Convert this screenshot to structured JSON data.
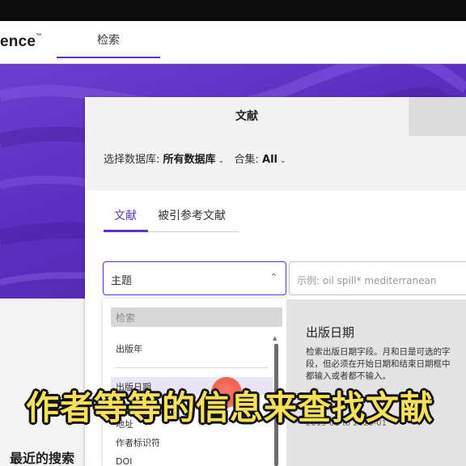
{
  "header": {
    "brand": "ence",
    "brand_mark": "™",
    "nav_tab": "检索"
  },
  "search_panel": {
    "header_tab": "文献",
    "database_label": "选择数据库:",
    "database_value": "所有数据库",
    "collection_label": "合集:",
    "collection_value": "All",
    "subtabs": [
      "文献",
      "被引参考文献"
    ],
    "field_select_value": "主题",
    "query_placeholder": "示例: oil spill* mediterranean"
  },
  "dropdown": {
    "search_placeholder": "检索",
    "items": [
      "出版年",
      "出版日期",
      "地址",
      "作者标识符",
      "DOI"
    ]
  },
  "info_card": {
    "title": "出版日期",
    "description": "检索出版日期字段。月和日是可选的字段，但必须在开始日期和结束日期框中都输入或者都不输入。",
    "example": "2019-01 to 2020-01"
  },
  "recent_searches": "最近的搜索",
  "caption": "作者等等的信息来查找文献",
  "colors": {
    "accent": "#5e33bf",
    "hero": "#5a2fbf",
    "caption_fill": "#f7e05a",
    "caption_stroke": "#111111"
  }
}
